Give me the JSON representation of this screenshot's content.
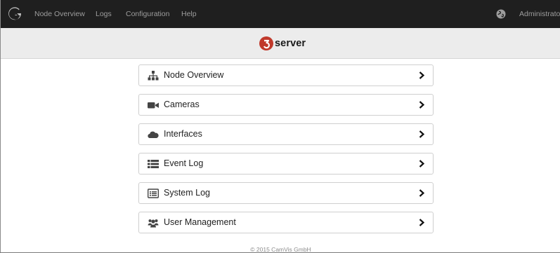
{
  "navbar": {
    "logo_icon": "g3-logo-icon",
    "links": [
      "Node Overview",
      "Logs",
      "Configuration",
      "Help"
    ],
    "globe_icon": "globe-icon",
    "user": "Administrator"
  },
  "brand": {
    "logo_icon": "g3-logo-icon",
    "text": "server"
  },
  "menu": [
    {
      "label": "Node Overview",
      "icon": "sitemap-icon"
    },
    {
      "label": "Cameras",
      "icon": "video-camera-icon"
    },
    {
      "label": "Interfaces",
      "icon": "cloud-icon"
    },
    {
      "label": "Event Log",
      "icon": "list-icon"
    },
    {
      "label": "System Log",
      "icon": "list-box-icon"
    },
    {
      "label": "User Management",
      "icon": "users-icon"
    }
  ],
  "footer": "© 2015 CamVis GmbH",
  "colors": {
    "navbar_bg": "#1f1f1f",
    "navbar_text": "#9d9d9d",
    "brandbar_bg": "#ececec",
    "logo_red": "#c0392b"
  }
}
